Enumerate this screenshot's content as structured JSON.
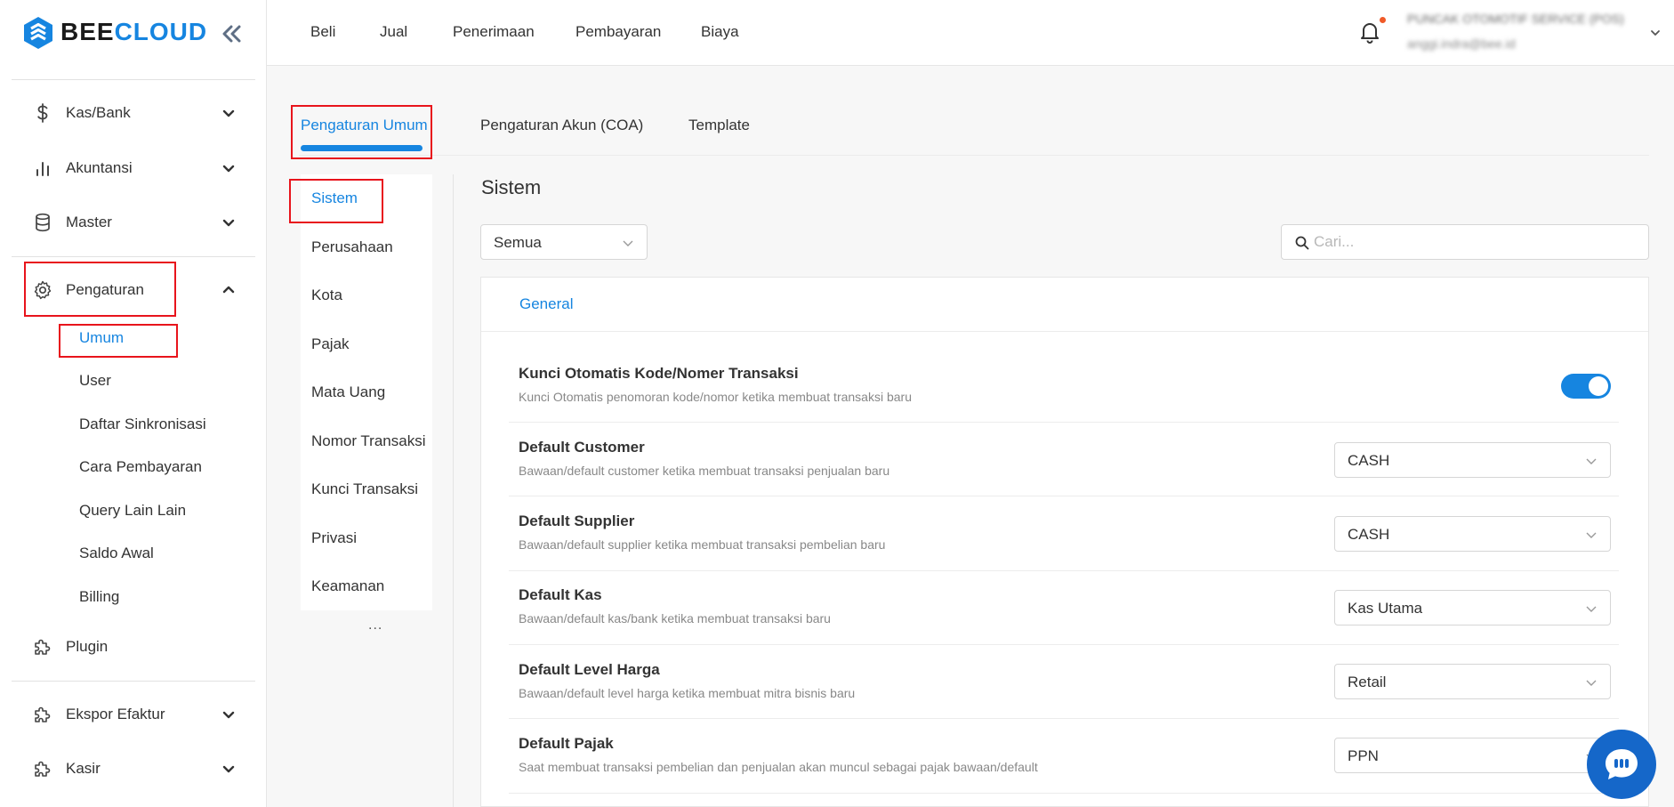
{
  "brand": {
    "bee": "BEE",
    "cloud": "CLOUD"
  },
  "sidebar": {
    "items": [
      {
        "label": "Kas/Bank"
      },
      {
        "label": "Akuntansi"
      },
      {
        "label": "Master"
      },
      {
        "label": "Pengaturan"
      },
      {
        "label": "Plugin"
      },
      {
        "label": "Ekspor Efaktur"
      },
      {
        "label": "Kasir"
      }
    ],
    "sub_items": [
      "Umum",
      "User",
      "Daftar Sinkronisasi",
      "Cara Pembayaran",
      "Query Lain Lain",
      "Saldo Awal",
      "Billing"
    ]
  },
  "topnav": [
    "Beli",
    "Jual",
    "Penerimaan",
    "Pembayaran",
    "Biaya"
  ],
  "user": {
    "company": "PUNCAK OTOMOTIF SERVICE (POS)",
    "email": "anggi.indra@bee.id"
  },
  "tabs": [
    "Pengaturan Umum",
    "Pengaturan Akun (COA)",
    "Template"
  ],
  "subnav": [
    "Sistem",
    "Perusahaan",
    "Kota",
    "Pajak",
    "Mata Uang",
    "Nomor Transaksi",
    "Kunci Transaksi",
    "Privasi",
    "Keamanan"
  ],
  "subnav_more": "...",
  "section_title": "Sistem",
  "filter": {
    "value": "Semua"
  },
  "search": {
    "placeholder": "Cari..."
  },
  "panel_tab": "General",
  "settings": [
    {
      "title": "Kunci Otomatis Kode/Nomer Transaksi",
      "desc": "Kunci Otomatis penomoran kode/nomor ketika membuat transaksi baru",
      "control": "toggle",
      "value": "on"
    },
    {
      "title": "Default Customer",
      "desc": "Bawaan/default customer ketika membuat transaksi penjualan baru",
      "control": "select",
      "value": "CASH"
    },
    {
      "title": "Default Supplier",
      "desc": "Bawaan/default supplier ketika membuat transaksi pembelian baru",
      "control": "select",
      "value": "CASH"
    },
    {
      "title": "Default Kas",
      "desc": "Bawaan/default kas/bank ketika membuat transaksi baru",
      "control": "select",
      "value": "Kas Utama"
    },
    {
      "title": "Default Level Harga",
      "desc": "Bawaan/default level harga ketika membuat mitra bisnis baru",
      "control": "select",
      "value": "Retail"
    },
    {
      "title": "Default Pajak",
      "desc": "Saat membuat transaksi pembelian dan penjualan akan muncul sebagai pajak bawaan/default",
      "control": "select",
      "value": "PPN"
    }
  ],
  "colors": {
    "accent": "#1685e0",
    "highlight_box": "#e8141c",
    "chat": "#1567c9",
    "notification_dot": "#f05a28"
  }
}
